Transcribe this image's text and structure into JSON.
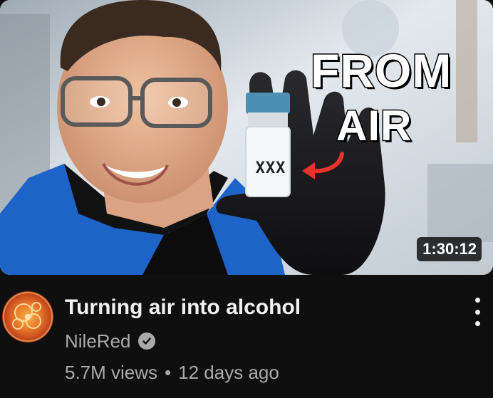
{
  "video": {
    "thumbnail_overlay": {
      "line1": "FROM",
      "line2": "AIR",
      "vial_label": "XXX"
    },
    "duration": "1:30:12",
    "title": "Turning air into alcohol",
    "channel": "NileRed",
    "channel_verified_icon": "check-circle-icon",
    "views": "5.7M views",
    "separator": "•",
    "age": "12 days ago",
    "menu_icon": "kebab-menu-icon"
  },
  "colors": {
    "background": "#0f0f0f",
    "title": "#f1f1f1",
    "meta": "#aaaaaa",
    "arrow": "#e8322a",
    "shirt": "#1e63c8"
  }
}
